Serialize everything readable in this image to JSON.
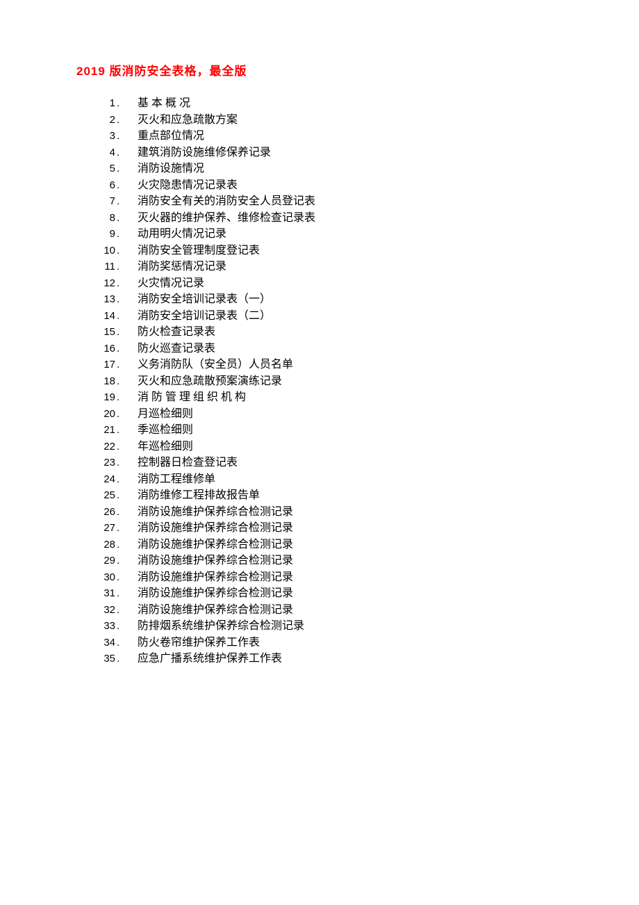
{
  "title": "2019 版消防安全表格，最全版",
  "items": [
    {
      "n": "1",
      "t": "基  本  概  况",
      "spaced": false
    },
    {
      "n": "2",
      "t": "灭火和应急疏散方案",
      "spaced": false
    },
    {
      "n": "3",
      "t": "重点部位情况",
      "spaced": false
    },
    {
      "n": "4",
      "t": "建筑消防设施维修保养记录",
      "spaced": false
    },
    {
      "n": "5",
      "t": "消防设施情况",
      "spaced": false
    },
    {
      "n": "6",
      "t": "火灾隐患情况记录表",
      "spaced": false
    },
    {
      "n": "7",
      "t": "消防安全有关的消防安全人员登记表",
      "spaced": false
    },
    {
      "n": "8",
      "t": "灭火器的维护保养、维修检查记录表",
      "spaced": false
    },
    {
      "n": "9",
      "t": "动用明火情况记录",
      "spaced": false
    },
    {
      "n": "10",
      "t": "消防安全管理制度登记表",
      "spaced": false
    },
    {
      "n": "11",
      "t": "消防奖惩情况记录",
      "spaced": false
    },
    {
      "n": "12",
      "t": "火灾情况记录",
      "spaced": false
    },
    {
      "n": "13",
      "t": "消防安全培训记录表（一）",
      "spaced": false
    },
    {
      "n": "14",
      "t": "消防安全培训记录表（二）",
      "spaced": false
    },
    {
      "n": "15",
      "t": "防火检查记录表",
      "spaced": false
    },
    {
      "n": "16",
      "t": "防火巡查记录表",
      "spaced": false
    },
    {
      "n": "17",
      "t": "义务消防队（安全员）人员名单",
      "spaced": false
    },
    {
      "n": "18",
      "t": "灭火和应急疏散预案演练记录",
      "spaced": false
    },
    {
      "n": "19",
      "t": "消 防 管 理 组 织 机 构",
      "spaced": false
    },
    {
      "n": "20",
      "t": "月巡检细则",
      "spaced": false
    },
    {
      "n": "21",
      "t": "季巡检细则",
      "spaced": false
    },
    {
      "n": "22",
      "t": "年巡检细则",
      "spaced": false
    },
    {
      "n": "23",
      "t": "控制器日检查登记表",
      "spaced": false
    },
    {
      "n": "24",
      "t": "消防工程维修单",
      "spaced": false
    },
    {
      "n": "25",
      "t": "消防维修工程排故报告单",
      "spaced": false
    },
    {
      "n": "26",
      "t": "消防设施维护保养综合检测记录",
      "spaced": false
    },
    {
      "n": "27",
      "t": "消防设施维护保养综合检测记录",
      "spaced": false
    },
    {
      "n": "28",
      "t": "消防设施维护保养综合检测记录",
      "spaced": false
    },
    {
      "n": "29",
      "t": "消防设施维护保养综合检测记录",
      "spaced": false
    },
    {
      "n": "30",
      "t": "消防设施维护保养综合检测记录",
      "spaced": false
    },
    {
      "n": "31",
      "t": "消防设施维护保养综合检测记录",
      "spaced": false
    },
    {
      "n": "32",
      "t": "消防设施维护保养综合检测记录",
      "spaced": false
    },
    {
      "n": "33",
      "t": "防排烟系统维护保养综合检测记录",
      "spaced": false
    },
    {
      "n": "34",
      "t": "防火卷帘维护保养工作表",
      "spaced": false
    },
    {
      "n": "35",
      "t": "应急广播系统维护保养工作表",
      "spaced": false
    }
  ]
}
